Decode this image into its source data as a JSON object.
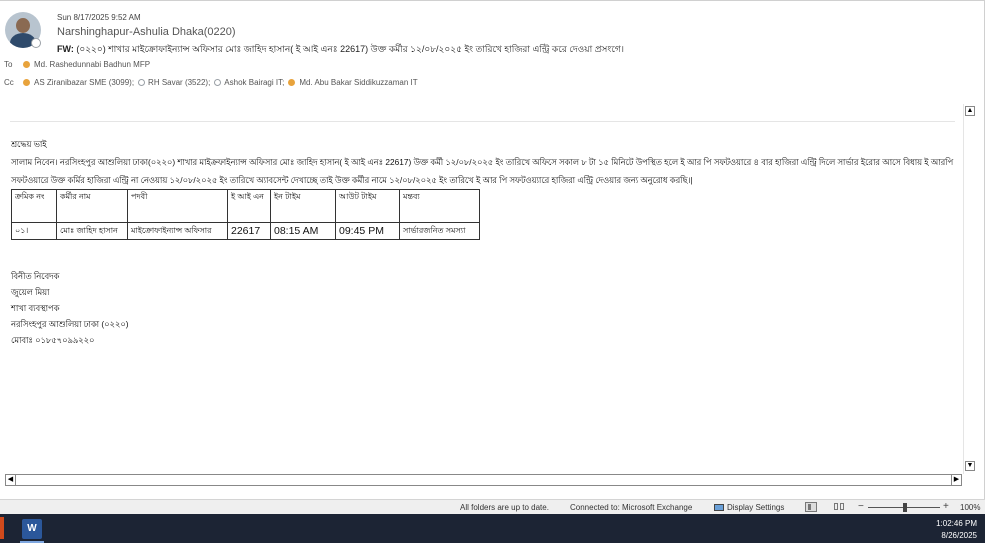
{
  "message": {
    "date": "Sun 8/17/2025 9:52 AM",
    "sender": "Narshinghapur-Ashulia Dhaka(0220)",
    "subject_prefix": "FW:",
    "subject": "(০২২০) শাখার মাইক্রোফাইন্যান্স অফিসার মোঃ জাহিদ হাসান( ই আই এনঃ 22617) উক্ত কর্মীর ১২/০৮/২০২৫ ইং তারিখে হাজিরা এন্ট্রি করে দেওয়া প্রসংগে।",
    "to_label": "To",
    "to": [
      {
        "name": "Md. Rashedunnabi Badhun MFP",
        "presence": "away"
      }
    ],
    "cc_label": "Cc",
    "cc": [
      {
        "name": "AS Ziranibazar SME (3099);",
        "presence": "away"
      },
      {
        "name": "RH Savar (3522);",
        "presence": "offline"
      },
      {
        "name": "Ashok Bairagi IT;",
        "presence": "offline"
      },
      {
        "name": "Md. Abu Bakar Siddikuzzaman IT",
        "presence": "away"
      }
    ]
  },
  "body": {
    "greeting": "শ্রদ্ধেয় ভাই",
    "paragraph_line1": "সালাম নিবেন। নরসিংহপুর আশুলিয়া ঢাকা(০২২০) শাখার মাইক্রফাইন্যান্স অফিসার মোঃ জাহিদ হাসান( ই আই এনঃ 22617) উক্ত কর্মী ১২/০৮/২০২৫ ইং তারিখে অফিসে সকাল ৮ টা ১৫ মিনিটে উপস্থিত হলে ই আর পি সফটওয়ারে ৪ বার হাজিরা এন্ট্রি দিলে সার্ভার ইরোর আসে বিধায় ই আরপি",
    "paragraph_line2": "সফটওয়ারে উক্ত কর্মির হাজিরা এন্ট্রি না নেওয়ায় ১২/০৮/২০২৫ ইং তারিখে  অ্যাবসেন্ট দেখাচ্ছে তাই উক্ত কর্মীর নামে ১২/০৮/২০২৫ ইং তারিখে ই আর পি সফটওয়্যারে  হাজিরা এন্ট্রি দেওয়ার জন্য অনুরোধ করছি।|",
    "table": {
      "headers": [
        "ক্রমিক নং",
        "কর্মীর নাম",
        "পদবী",
        "ই আই এন",
        "ইন টাইম",
        "আউট টাইম",
        "মন্তব্য"
      ],
      "rows": [
        [
          "০১।",
          "মোঃ জাহিদ হাসান",
          "মাইক্রোফাইন্যান্স অফিসার",
          "22617",
          "08:15 AM",
          "09:45 PM",
          "সার্ভারজনিত সমস্যা"
        ]
      ]
    },
    "signature": [
      "বিনীত নিবেদক",
      "জুয়েল মিয়া",
      "শাখা ব্যবস্থাপক",
      "নরসিংহপুর আশুলিয়া ঢাকা (০২২০)",
      "মোবাঃ ০১৮৫৭০৯৯২২০"
    ]
  },
  "statusbar": {
    "folders": "All folders are up to date.",
    "connection": "Connected to: Microsoft Exchange",
    "display_settings": "Display Settings",
    "zoom_minus": "−",
    "zoom_plus": "+",
    "zoom": "100%",
    "zoom_value": 100
  },
  "taskbar": {
    "word_letter": "W",
    "time": "1:02:46 PM",
    "date": "8/26/2025"
  },
  "scroll": {
    "up": "▲",
    "down": "▼",
    "left": "◀",
    "right": "▶"
  },
  "colors": {
    "presence_away": "#e8a33c",
    "word_blue": "#2b579a",
    "taskbar": "#1c2434"
  }
}
